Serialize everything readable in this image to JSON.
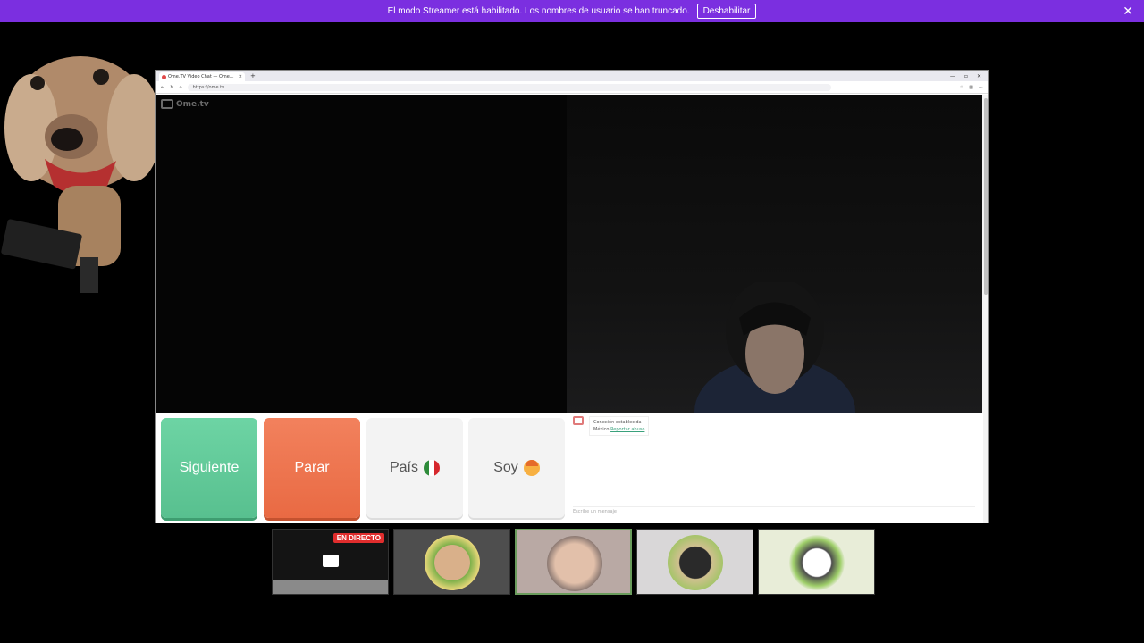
{
  "banner": {
    "text": "El modo Streamer está habilitado. Los nombres de usuario se han truncado.",
    "button_label": "Deshabilitar",
    "close_glyph": "✕",
    "color": "#7b2fe0"
  },
  "browser": {
    "tab_title": "Ome.TV Video Chat — Ome...",
    "tab_close": "×",
    "new_tab": "+",
    "window_controls": [
      "—",
      "▫",
      "✕"
    ],
    "url": "https://ome.tv"
  },
  "site": {
    "logo_text": "Ome.tv"
  },
  "controls": {
    "next_label": "Siguiente",
    "stop_label": "Parar",
    "country_label": "País",
    "soy_label": "Soy",
    "next_color": "#6dd4a4",
    "stop_color": "#e96a43"
  },
  "chat": {
    "line1": "Conexión establecida",
    "line2_prefix": "México",
    "line2_link": "Reportar abuso",
    "input_placeholder": "Escribe un mensaje"
  },
  "thumbnails": {
    "live_badge": "EN DIRECTO"
  },
  "icons": [
    "close-icon",
    "mexico-flag-icon",
    "boy-face-icon",
    "pointer-cursor-icon",
    "chat-camera-icon"
  ]
}
